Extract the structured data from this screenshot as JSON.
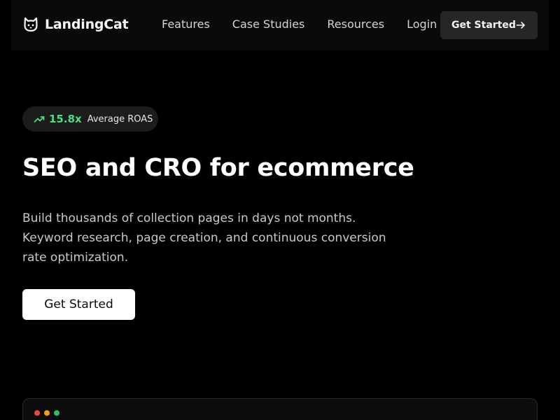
{
  "header": {
    "brand_name": "LandingCat",
    "brand_icon": "cat-icon",
    "nav": [
      "Features",
      "Case Studies",
      "Resources",
      "Login"
    ],
    "cta_label": "Get Started",
    "cta_icon": "arrow-right-icon"
  },
  "badge": {
    "icon": "trending-up-icon",
    "value": "15.8x",
    "label": "Average ROAS",
    "accent_color": "#4ade80"
  },
  "hero": {
    "title": "SEO and CRO for ecommerce",
    "description_lines": [
      "Build thousands of collection pages in days not months.",
      "Keyword research, page creation, and continuous conversion",
      "rate optimization."
    ],
    "cta_label": "Get Started"
  },
  "preview": {
    "window_dots": [
      "#ef4444",
      "#f59e0b",
      "#22c55e"
    ]
  }
}
